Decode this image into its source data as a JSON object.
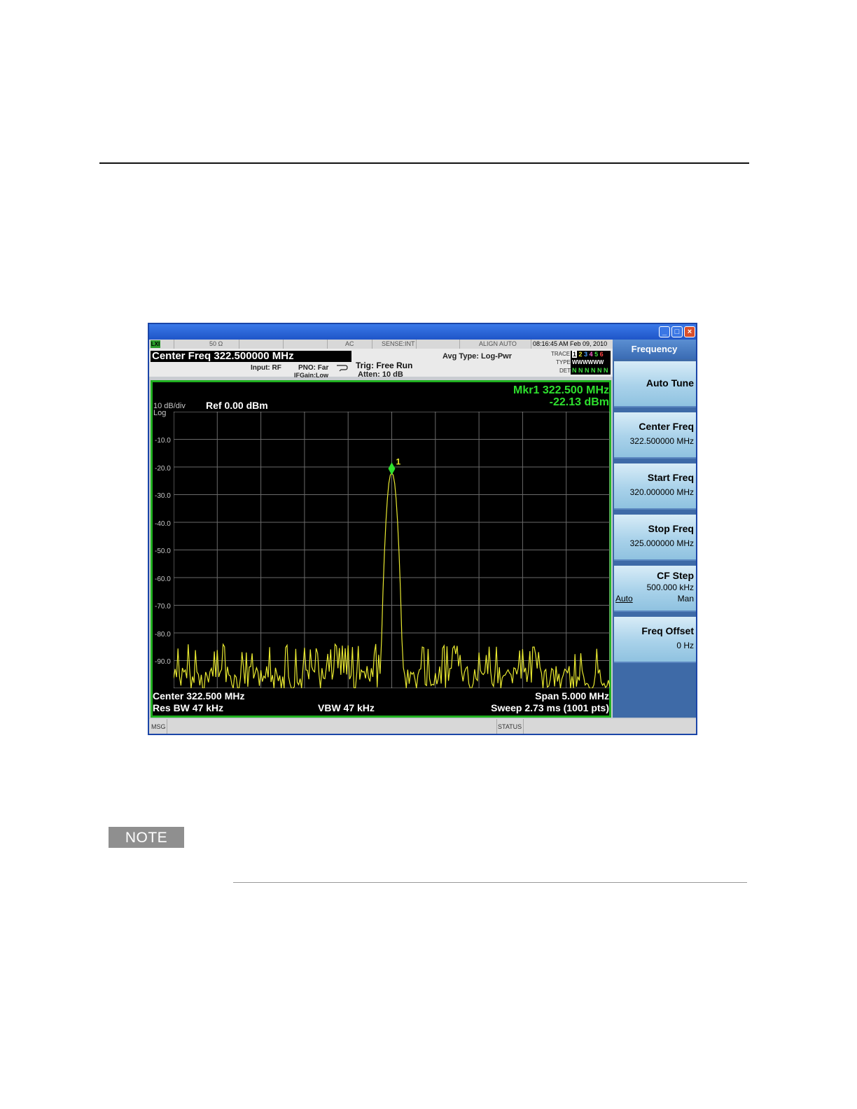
{
  "note_label": "NOTE",
  "window": {
    "status": {
      "impedance": "50 Ω",
      "coupling": "AC",
      "sense": "SENSE:INT",
      "align": "ALIGN AUTO",
      "datetime": "08:16:45 AM Feb 09, 2010"
    },
    "header": {
      "center_freq": "Center Freq  322.500000 MHz",
      "input": "Input: RF",
      "pno": "PNO: Far",
      "ifgain": "IFGain:Low",
      "trig": "Trig: Free Run",
      "atten": "Atten: 10 dB",
      "avg_type": "Avg Type: Log-Pwr",
      "trace_label": "TRACE",
      "type_label": "TYPE",
      "det_label": "DET",
      "trace_numbers": [
        "1",
        "2",
        "3",
        "4",
        "5",
        "6"
      ],
      "type_row": "WWWWWW",
      "det_row": "N N N N N N"
    },
    "plot": {
      "scale": "10 dB/div",
      "log": "Log",
      "ref": "Ref 0.00 dBm",
      "marker_freq": "Mkr1 322.500 MHz",
      "marker_level": "-22.13 dBm",
      "marker_id": "1",
      "center": "Center 322.500 MHz",
      "res_bw": "Res BW 47 kHz",
      "vbw": "VBW 47 kHz",
      "span": "Span 5.000 MHz",
      "sweep": "Sweep  2.73 ms (1001 pts)",
      "y_ticks": [
        "-10.0",
        "-20.0",
        "-30.0",
        "-40.0",
        "-50.0",
        "-60.0",
        "-70.0",
        "-80.0",
        "-90.0"
      ]
    },
    "softkeys": {
      "menu_title": "Frequency",
      "auto_tune": "Auto Tune",
      "center_freq_label": "Center Freq",
      "center_freq_value": "322.500000 MHz",
      "start_freq_label": "Start Freq",
      "start_freq_value": "320.000000 MHz",
      "stop_freq_label": "Stop Freq",
      "stop_freq_value": "325.000000 MHz",
      "cf_step_label": "CF Step",
      "cf_step_value": "500.000 kHz",
      "cf_step_auto": "Auto",
      "cf_step_man": "Man",
      "freq_offset_label": "Freq Offset",
      "freq_offset_value": "0 Hz"
    },
    "msgbar": {
      "msg": "MSG",
      "status": "STATUS"
    }
  },
  "colors": {
    "trace": "#e8e830",
    "marker": "#2ee02e",
    "border": "#20b020"
  }
}
